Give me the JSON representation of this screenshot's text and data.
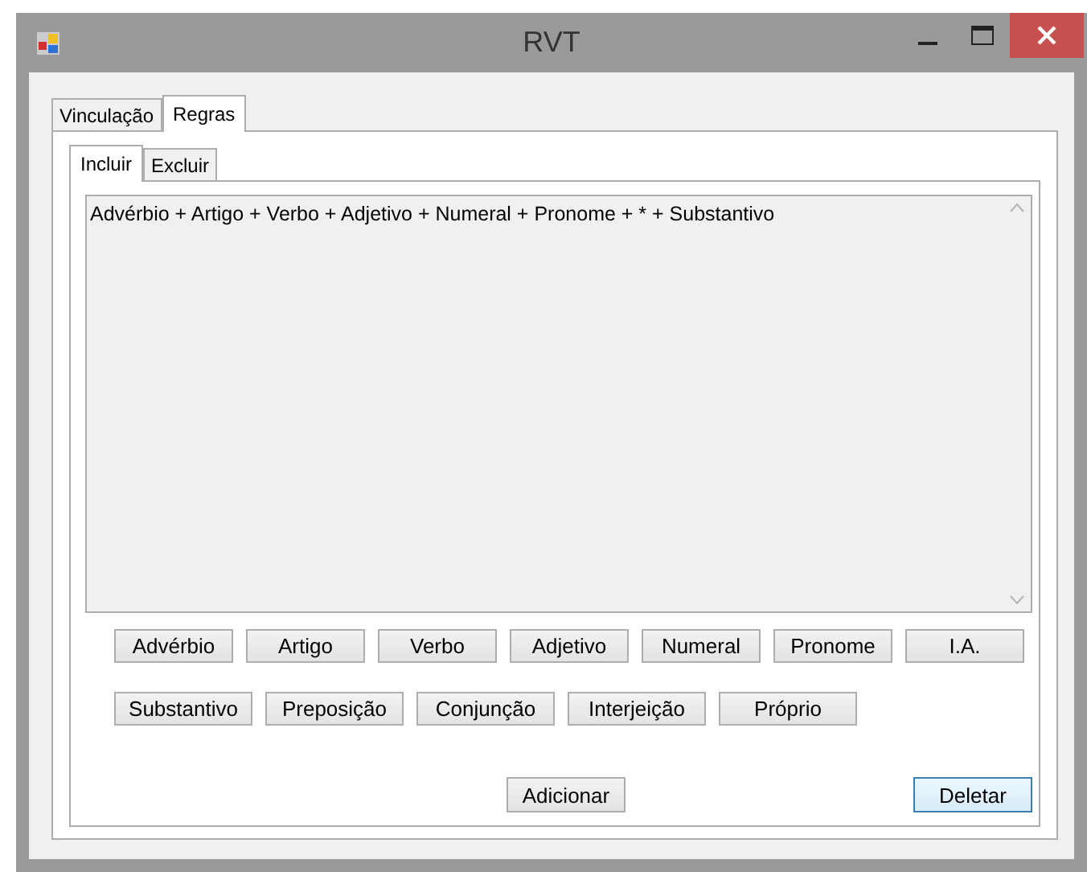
{
  "window": {
    "title": "RVT"
  },
  "tabs": [
    {
      "label": "Vinculação",
      "selected": false
    },
    {
      "label": "Regras",
      "selected": true
    }
  ],
  "subtabs": [
    {
      "label": "Incluir",
      "selected": true
    },
    {
      "label": "Excluir",
      "selected": false
    }
  ],
  "rule_text": "Advérbio + Artigo + Verbo + Adjetivo + Numeral + Pronome + * + Substantivo",
  "word_buttons_row_1": [
    "Advérbio",
    "Artigo",
    "Verbo",
    "Adjetivo",
    "Numeral",
    "Pronome",
    "I.A."
  ],
  "word_buttons_row_2": [
    "Substantivo",
    "Preposição",
    "Conjunção",
    "Interjeição",
    "Próprio"
  ],
  "action_buttons": [
    {
      "label": "Adicionar",
      "focused": false
    },
    {
      "label": "Deletar",
      "focused": true
    }
  ]
}
